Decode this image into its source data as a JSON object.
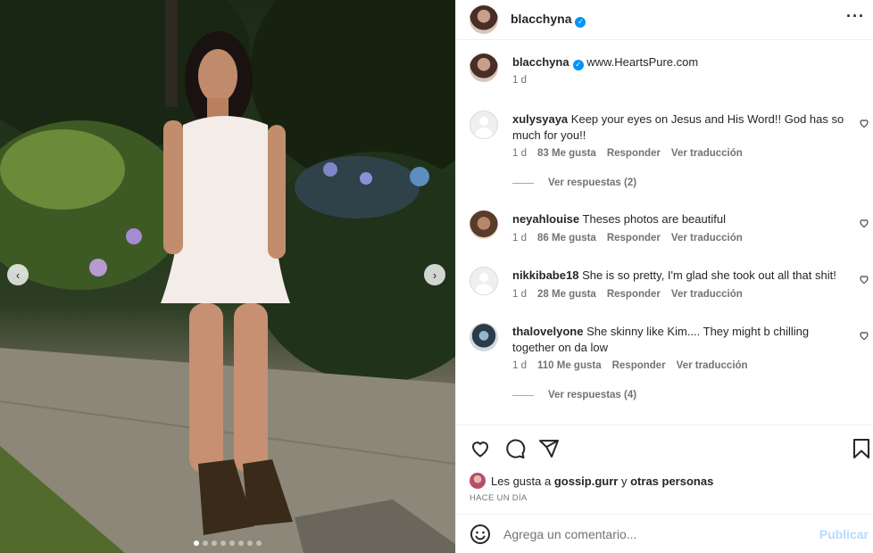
{
  "post": {
    "author": "blacchyna",
    "verified": true,
    "caption": "www.HeartsPure.com",
    "caption_time": "1 d",
    "carousel": {
      "slides": 8,
      "current": 1
    }
  },
  "comments": [
    {
      "user": "xulysyaya",
      "text": "Keep your eyes on Jesus and His Word!! God has so much for you!!",
      "time": "1 d",
      "likes": "83 Me gusta",
      "reply": "Responder",
      "translate": "Ver traducción",
      "view_replies": "Ver respuestas (2)"
    },
    {
      "user": "neyahlouise",
      "text": "Theses photos are beautiful",
      "time": "1 d",
      "likes": "86 Me gusta",
      "reply": "Responder",
      "translate": "Ver traducción"
    },
    {
      "user": "nikkibabe18",
      "text": "She is so pretty, I'm glad she took out all that shit!",
      "time": "1 d",
      "likes": "28 Me gusta",
      "reply": "Responder",
      "translate": "Ver traducción"
    },
    {
      "user": "thalovelyone",
      "text": "She skinny like Kim.... They might b chilling together on da low",
      "time": "1 d",
      "likes": "110 Me gusta",
      "reply": "Responder",
      "translate": "Ver traducción",
      "view_replies": "Ver respuestas (4)"
    }
  ],
  "likes_line": {
    "prefix": "Les gusta a",
    "user": "gossip.gurr",
    "joiner": "y",
    "others": "otras personas"
  },
  "timestamp": "HACE UN DÍA",
  "composer": {
    "placeholder": "Agrega un comentario...",
    "publish": "Publicar"
  },
  "icons": {
    "more": "more-options-icon",
    "like": "heart-icon",
    "comment": "comment-icon",
    "share": "share-icon",
    "save": "bookmark-icon",
    "emoji": "emoji-icon",
    "prev": "chevron-left-icon",
    "next": "chevron-right-icon"
  },
  "colors": {
    "verified": "#0095f6",
    "publish_disabled": "#b3dbff",
    "muted": "#737373"
  }
}
